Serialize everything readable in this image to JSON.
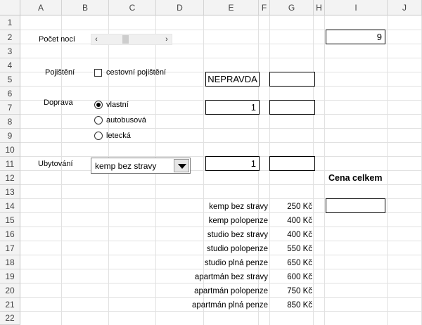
{
  "sheet": {
    "columns": [
      "A",
      "B",
      "C",
      "D",
      "E",
      "F",
      "G",
      "H",
      "I",
      "J"
    ],
    "rows": [
      "1",
      "2",
      "3",
      "4",
      "5",
      "6",
      "7",
      "8",
      "9",
      "10",
      "11",
      "12",
      "13",
      "14",
      "15",
      "16",
      "17",
      "18",
      "19",
      "20",
      "21",
      "22"
    ]
  },
  "form": {
    "nights_label": "Počet nocí",
    "nights_value": "9",
    "insurance_label": "Pojištění",
    "insurance_checkbox_label": "cestovní pojištění",
    "insurance_checked": false,
    "insurance_cell": "NEPRAVDA",
    "transport_label": "Doprava",
    "transport_options": [
      "vlastní",
      "autobusová",
      "letecká"
    ],
    "transport_selected": "vlastní",
    "transport_cell": "1",
    "accommodation_label": "Ubytování",
    "accommodation_selected": "kemp bez stravy",
    "accommodation_cell": "1",
    "total_label": "Cena celkem"
  },
  "prices": [
    {
      "name": "kemp bez stravy",
      "price": "250 Kč"
    },
    {
      "name": "kemp polopenze",
      "price": "400 Kč"
    },
    {
      "name": "studio bez stravy",
      "price": "400 Kč"
    },
    {
      "name": "studio polopenze",
      "price": "550 Kč"
    },
    {
      "name": "studio plná penze",
      "price": "650 Kč"
    },
    {
      "name": "apartmán bez stravy",
      "price": "600 Kč"
    },
    {
      "name": "apartmán polopenze",
      "price": "750 Kč"
    },
    {
      "name": "apartmán plná penze",
      "price": "850 Kč"
    }
  ],
  "icons": {
    "scroll_left": "chevron-left-icon",
    "scroll_right": "chevron-right-icon",
    "dropdown": "triangle-down-icon"
  }
}
